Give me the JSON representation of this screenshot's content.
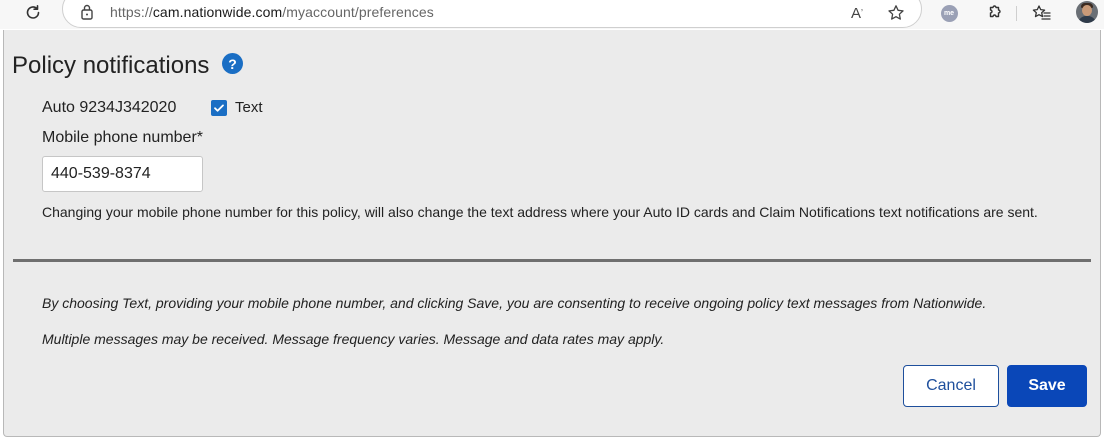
{
  "browser": {
    "url_scheme": "https://",
    "url_host": "cam.nationwide.com",
    "url_path": "/myaccount/preferences",
    "profile_initials": "me",
    "icons": [
      "refresh-icon",
      "lock-icon",
      "read-aloud-icon",
      "star-icon",
      "profile-icon",
      "extensions-icon",
      "favorites-icon",
      "avatar"
    ]
  },
  "page": {
    "title": "Policy notifications",
    "help_glyph": "?",
    "policy_label": "Auto 9234J342020",
    "text_option": {
      "label": "Text",
      "checked": true
    },
    "phone": {
      "label": "Mobile phone number*",
      "value": "440-539-8374"
    },
    "notice": "Changing your mobile phone number for this policy, will also change the text address where your Auto ID cards and Claim Notifications text notifications are sent.",
    "consent_line1": "By choosing Text, providing your mobile phone number, and clicking Save, you are consenting to receive ongoing policy text messages from Nationwide.",
    "consent_line2": "Multiple messages may be received. Message frequency varies. Message and data rates may apply.",
    "cancel_label": "Cancel",
    "save_label": "Save"
  },
  "colors": {
    "accent": "#1a6ec4",
    "save_button": "#0a47b8",
    "panel_bg": "#ebebeb"
  }
}
